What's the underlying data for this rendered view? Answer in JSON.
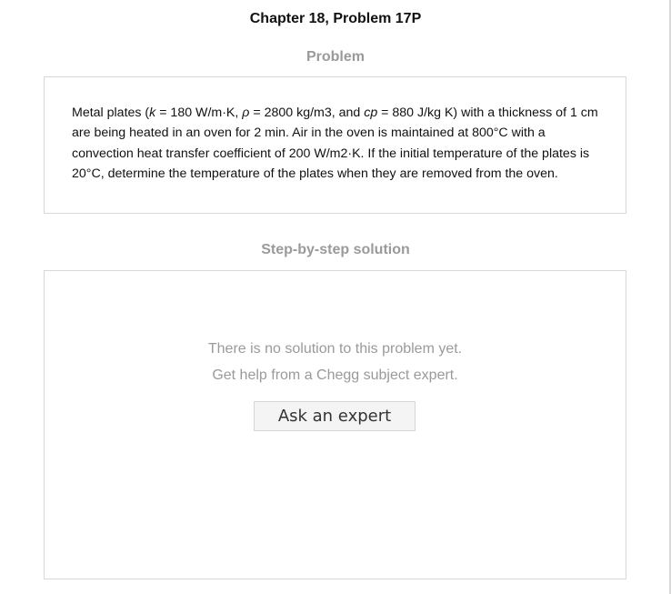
{
  "header": {
    "chapter_title": "Chapter 18, Problem 17P"
  },
  "problem": {
    "heading": "Problem",
    "text_parts": {
      "p1": "Metal plates (",
      "k_symbol": "k",
      "p2": " = 180 W/m·K, ",
      "rho_symbol": "ρ",
      "p3": " = 2800 kg/m3, and ",
      "cp_symbol": "cp",
      "p4": " = 880 J/kg K) with a thickness of 1 cm are being heated in an oven for 2 min. Air in the oven is maintained at 800°C with a convection heat transfer coefficient of 200 W/m2·K. If the initial temperature of the plates is 20°C, determine the temperature of the plates when they are removed from the oven."
    }
  },
  "solution": {
    "heading": "Step-by-step solution",
    "empty_line_1": "There is no solution to this problem yet.",
    "empty_line_2": "Get help from a Chegg subject expert.",
    "ask_button_label": "Ask an expert"
  }
}
